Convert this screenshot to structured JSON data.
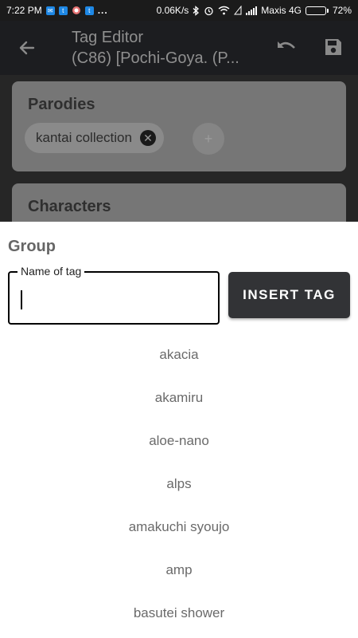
{
  "status_bar": {
    "time": "7:22 PM",
    "speed": "0.06K/s",
    "carrier": "Maxis 4G",
    "battery_percent": "72%",
    "battery_level": 0.72,
    "more": "..."
  },
  "app_bar": {
    "title": "Tag Editor",
    "subtitle": "(C86) [Pochi-Goya. (P..."
  },
  "background": {
    "parodies_title": "Parodies",
    "parody_tag": "kantai collection",
    "add_symbol": "+",
    "characters_title": "Characters"
  },
  "sheet": {
    "title": "Group",
    "field_label": "Name of tag",
    "field_value": "",
    "insert_label": "INSERT TAG",
    "suggestions": [
      "akacia",
      "akamiru",
      "aloe-nano",
      "alps",
      "amakuchi syoujo",
      "amp",
      "basutei shower"
    ]
  }
}
